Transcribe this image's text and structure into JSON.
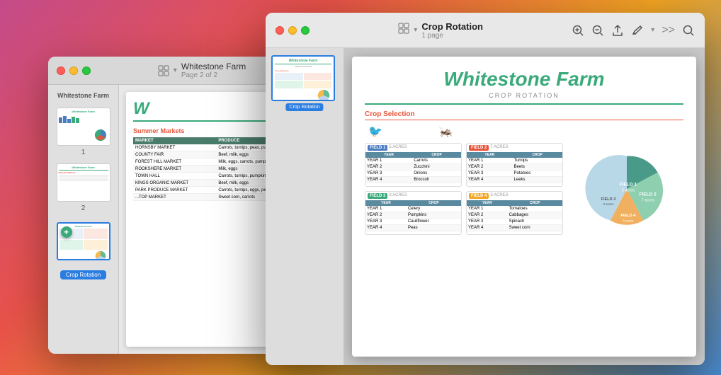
{
  "back_window": {
    "title": "Whitestone Farm",
    "subtitle": "Page 2 of 2",
    "sidebar_label": "Whitestone Farm",
    "thumb1_label": "1",
    "thumb2_label": "2",
    "section": "Summer Markets",
    "table": {
      "headers": [
        "MARKET",
        "PRODUCE"
      ],
      "rows": [
        [
          "HORNSBY MARKET",
          "Carrots, turnips, peas, pum..."
        ],
        [
          "COUNTY FAIR",
          "Beef, milk, eggs"
        ],
        [
          "FOREST HILL MARKET",
          "Milk, eggs, carrots, pumpkins"
        ],
        [
          "ROOKSHERE MARKET",
          "Milk, eggs"
        ],
        [
          "TOWN HALL",
          "Carrots, turnips, pumpkins"
        ],
        [
          "KINGS ORGANIC MARKET",
          "Beef, milk, eggs"
        ],
        [
          "PARK PRODUCE MARKET",
          "Carrots, turnips, eggs, peas, pumpkins"
        ],
        [
          "...TOP MARKET",
          "Sweet corn, carrots"
        ]
      ]
    }
  },
  "front_window": {
    "title": "Crop Rotation",
    "subtitle": "1 page",
    "document": {
      "title": "Whitestone Farm",
      "subtitle": "CROP ROTATION",
      "section": "Crop Selection",
      "fields": [
        {
          "label": "FIELD 1",
          "color": "f1-color",
          "acres": "5 ACRES",
          "rows": [
            [
              "YEAR 1",
              "Carrots"
            ],
            [
              "YEAR 2",
              "Zucchini"
            ],
            [
              "YEAR 3",
              "Onions"
            ],
            [
              "YEAR 4",
              "Broccoli"
            ]
          ]
        },
        {
          "label": "FIELD 2",
          "color": "f2-color",
          "acres": "7 ACRES",
          "rows": [
            [
              "YEAR 1",
              "Turnips"
            ],
            [
              "YEAR 2",
              "Beets"
            ],
            [
              "YEAR 3",
              "Potatoes"
            ],
            [
              "YEAR 4",
              "Leeks"
            ]
          ]
        },
        {
          "label": "FIELD 3",
          "color": "f3-color",
          "acres": "3 ACRES",
          "rows": [
            [
              "YEAR 1",
              "Celery"
            ],
            [
              "YEAR 2",
              "Pumpkins"
            ],
            [
              "YEAR 3",
              "Cauliflower"
            ],
            [
              "YEAR 4",
              "Peas"
            ]
          ]
        },
        {
          "label": "FIELD 4",
          "color": "f4-color",
          "acres": "3 ACRES",
          "rows": [
            [
              "YEAR 1",
              "Tomatoes"
            ],
            [
              "YEAR 2",
              "Cabbages"
            ],
            [
              "YEAR 3",
              "Spinach"
            ],
            [
              "YEAR 4",
              "Sweet corn"
            ]
          ]
        }
      ],
      "pie_legend": [
        {
          "label": "FIELD 1",
          "sublabel": "5 acres",
          "color": "#b0c8e8"
        },
        {
          "label": "FIELD 2",
          "sublabel": "7 acres",
          "color": "#8ec8a0"
        },
        {
          "label": "FIELD 3",
          "sublabel": "3 acres",
          "color": "#f5a623"
        },
        {
          "label": "FIELD 4",
          "sublabel": "3 acres",
          "color": "#f5a623"
        }
      ]
    },
    "thumb_badge": "Crop Rotation"
  },
  "crop_thumb_badge": "Crop Rotation",
  "icons": {
    "view": "⊞",
    "zoom_in": "🔍",
    "zoom_out": "🔍",
    "share": "⬆",
    "pen": "✏",
    "more": "›",
    "search": "🔍",
    "chevron": "›"
  }
}
